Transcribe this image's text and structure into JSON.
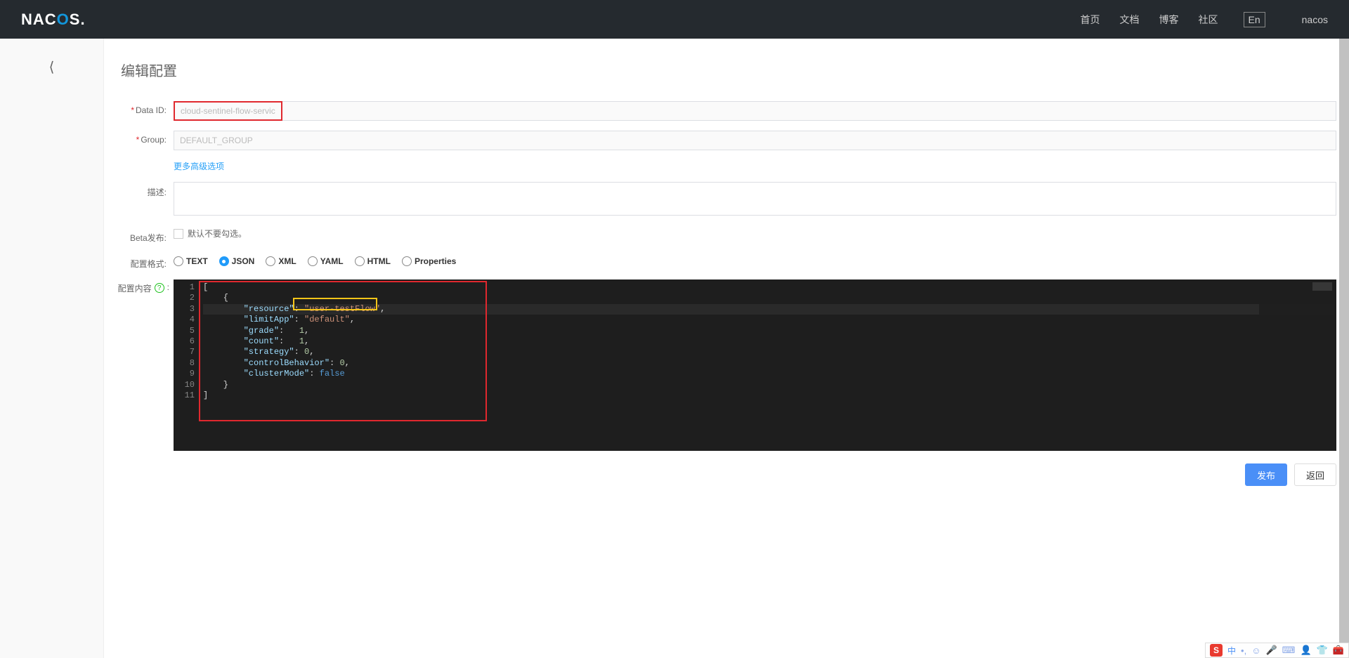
{
  "header": {
    "nav": {
      "home": "首页",
      "docs": "文档",
      "blog": "博客",
      "community": "社区",
      "lang": "En",
      "user": "nacos"
    }
  },
  "page": {
    "title": "编辑配置",
    "labels": {
      "dataId": "Data ID:",
      "group": "Group:",
      "more": "更多高级选项",
      "desc": "描述:",
      "beta": "Beta发布:",
      "betaHint": "默认不要勾选。",
      "format": "配置格式:",
      "content": "配置内容"
    },
    "fields": {
      "dataId": "cloud-sentinel-flow-service",
      "group": "DEFAULT_GROUP"
    },
    "formats": {
      "text": "TEXT",
      "json": "JSON",
      "xml": "XML",
      "yaml": "YAML",
      "html": "HTML",
      "properties": "Properties"
    },
    "code": {
      "resource_key": "\"resource\"",
      "resource_val": "\"user-testFlow\"",
      "limitApp_key": "\"limitApp\"",
      "limitApp_val": "\"default\"",
      "grade_key": "\"grade\"",
      "grade_val": "1",
      "count_key": "\"count\"",
      "count_val": "1",
      "strategy_key": "\"strategy\"",
      "strategy_val": "0",
      "ctrlBeh_key": "\"controlBehavior\"",
      "ctrlBeh_val": "0",
      "cluster_key": "\"clusterMode\"",
      "cluster_val": "false"
    },
    "buttons": {
      "publish": "发布",
      "back": "返回"
    }
  },
  "ime": {
    "cn": "中"
  }
}
